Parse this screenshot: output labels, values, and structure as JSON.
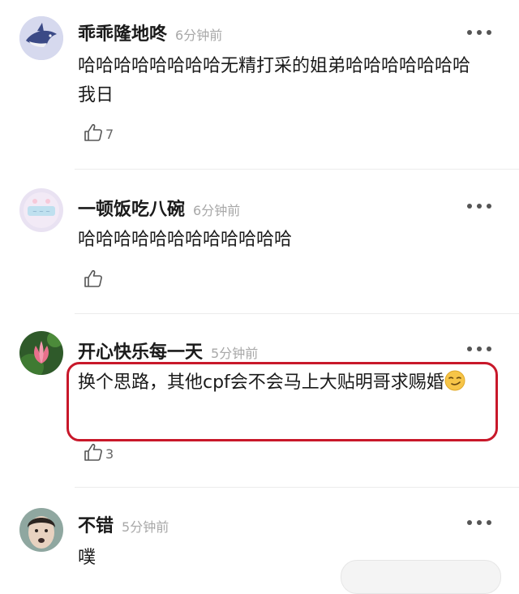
{
  "comments": [
    {
      "username": "乖乖隆地咚",
      "time": "6分钟前",
      "text": "哈哈哈哈哈哈哈哈无精打采的姐弟哈哈哈哈哈哈哈 我日",
      "likes": "7",
      "avatar_icon": "shark-avatar-icon"
    },
    {
      "username": "一顿饭吃八碗",
      "time": "6分钟前",
      "text": "哈哈哈哈哈哈哈哈哈哈哈哈",
      "likes": "",
      "avatar_icon": "pastel-avatar-icon"
    },
    {
      "username": "开心快乐每一天",
      "time": "5分钟前",
      "text": "换个思路，其他cpf会不会马上大贴明哥求赐婚",
      "likes": "3",
      "avatar_icon": "lotus-avatar-icon"
    },
    {
      "username": "不错",
      "time": "5分钟前",
      "text": "噗",
      "likes": "",
      "avatar_icon": "face-avatar-icon"
    }
  ],
  "colors": {
    "highlight_border": "#c8182a",
    "time_gray": "#a8a8a8",
    "emoji": "smirk-emoji"
  }
}
